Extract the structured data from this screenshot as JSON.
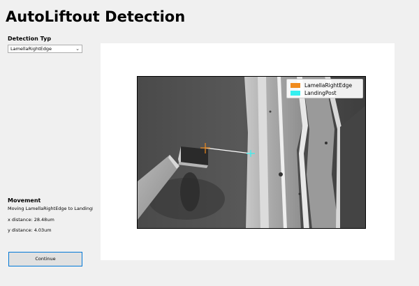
{
  "app": {
    "title": "AutoLiftout Detection"
  },
  "detection": {
    "label": "Detection Typ",
    "selected": "LamellaRightEdge"
  },
  "movement": {
    "label": "Movement",
    "text": "Moving LamellaRightEdge to LandingP",
    "x_distance": "x distance: 28.48um",
    "y_distance": "y distance: 4.03um"
  },
  "continue_button": {
    "label": "Continue"
  },
  "legend": [
    {
      "label": "LamellaRightEdge",
      "color": "#f08a1c"
    },
    {
      "label": "LandingPost",
      "color": "#34f0f0"
    }
  ],
  "markers": {
    "lamella_right_edge_color": "#f08a1c",
    "landing_post_color": "#34f0f0",
    "connector_color": "#ffffff"
  },
  "icons": {
    "combo_arrow": "chevron-down-icon"
  }
}
